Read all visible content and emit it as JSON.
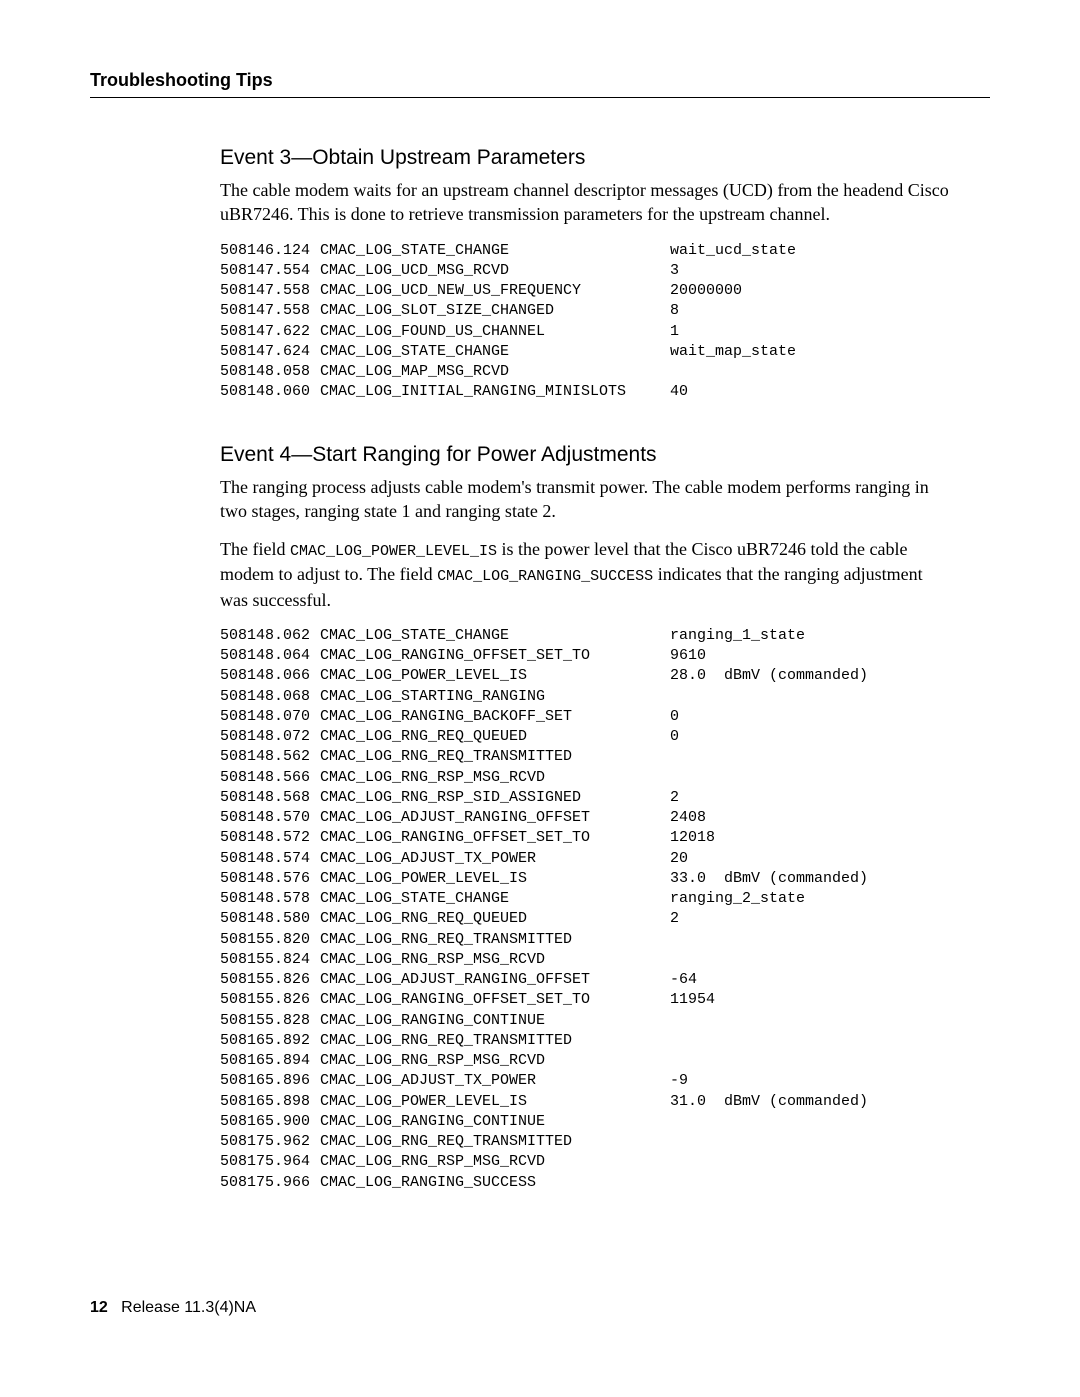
{
  "header": {
    "title": "Troubleshooting Tips"
  },
  "section1": {
    "heading": "Event  3—Obtain Upstream Parameters",
    "para": "The cable modem waits for an upstream channel descriptor messages (UCD) from the headend Cisco uBR7246. This is done to retrieve transmission parameters for the upstream channel.",
    "log": [
      {
        "ts": "508146.124",
        "ev": "CMAC_LOG_STATE_CHANGE",
        "val": "wait_ucd_state"
      },
      {
        "ts": "508147.554",
        "ev": "CMAC_LOG_UCD_MSG_RCVD",
        "val": "3"
      },
      {
        "ts": "508147.558",
        "ev": "CMAC_LOG_UCD_NEW_US_FREQUENCY",
        "val": "20000000"
      },
      {
        "ts": "508147.558",
        "ev": "CMAC_LOG_SLOT_SIZE_CHANGED",
        "val": "8"
      },
      {
        "ts": "508147.622",
        "ev": "CMAC_LOG_FOUND_US_CHANNEL",
        "val": "1"
      },
      {
        "ts": "508147.624",
        "ev": "CMAC_LOG_STATE_CHANGE",
        "val": "wait_map_state"
      },
      {
        "ts": "508148.058",
        "ev": "CMAC_LOG_MAP_MSG_RCVD",
        "val": ""
      },
      {
        "ts": "508148.060",
        "ev": "CMAC_LOG_INITIAL_RANGING_MINISLOTS",
        "val": "40"
      }
    ]
  },
  "section2": {
    "heading": "Event  4—Start Ranging for Power Adjustments",
    "para1": "The ranging process adjusts cable modem's transmit power. The cable modem performs ranging in two stages, ranging state 1 and ranging state 2.",
    "para2a": "The field ",
    "code1": "CMAC_LOG_POWER_LEVEL_IS",
    "para2b": " is the power level that the Cisco uBR7246 told the cable modem to adjust to. The field ",
    "code2": "CMAC_LOG_RANGING_SUCCESS",
    "para2c": " indicates that the ranging adjustment was successful.",
    "log": [
      {
        "ts": "508148.062",
        "ev": "CMAC_LOG_STATE_CHANGE",
        "val": "ranging_1_state"
      },
      {
        "ts": "508148.064",
        "ev": "CMAC_LOG_RANGING_OFFSET_SET_TO",
        "val": "9610"
      },
      {
        "ts": "508148.066",
        "ev": "CMAC_LOG_POWER_LEVEL_IS",
        "val": "28.0  dBmV (commanded)"
      },
      {
        "ts": "508148.068",
        "ev": "CMAC_LOG_STARTING_RANGING",
        "val": ""
      },
      {
        "ts": "508148.070",
        "ev": "CMAC_LOG_RANGING_BACKOFF_SET",
        "val": "0"
      },
      {
        "ts": "508148.072",
        "ev": "CMAC_LOG_RNG_REQ_QUEUED",
        "val": "0"
      },
      {
        "ts": "508148.562",
        "ev": "CMAC_LOG_RNG_REQ_TRANSMITTED",
        "val": ""
      },
      {
        "ts": "508148.566",
        "ev": "CMAC_LOG_RNG_RSP_MSG_RCVD",
        "val": ""
      },
      {
        "ts": "508148.568",
        "ev": "CMAC_LOG_RNG_RSP_SID_ASSIGNED",
        "val": "2"
      },
      {
        "ts": "508148.570",
        "ev": "CMAC_LOG_ADJUST_RANGING_OFFSET",
        "val": "2408"
      },
      {
        "ts": "508148.572",
        "ev": "CMAC_LOG_RANGING_OFFSET_SET_TO",
        "val": "12018"
      },
      {
        "ts": "508148.574",
        "ev": "CMAC_LOG_ADJUST_TX_POWER",
        "val": "20"
      },
      {
        "ts": "508148.576",
        "ev": "CMAC_LOG_POWER_LEVEL_IS",
        "val": "33.0  dBmV (commanded)"
      },
      {
        "ts": "508148.578",
        "ev": "CMAC_LOG_STATE_CHANGE",
        "val": "ranging_2_state"
      },
      {
        "ts": "508148.580",
        "ev": "CMAC_LOG_RNG_REQ_QUEUED",
        "val": "2"
      },
      {
        "ts": "508155.820",
        "ev": "CMAC_LOG_RNG_REQ_TRANSMITTED",
        "val": ""
      },
      {
        "ts": "508155.824",
        "ev": "CMAC_LOG_RNG_RSP_MSG_RCVD",
        "val": ""
      },
      {
        "ts": "508155.826",
        "ev": "CMAC_LOG_ADJUST_RANGING_OFFSET",
        "val": "-64"
      },
      {
        "ts": "508155.826",
        "ev": "CMAC_LOG_RANGING_OFFSET_SET_TO",
        "val": "11954"
      },
      {
        "ts": "508155.828",
        "ev": "CMAC_LOG_RANGING_CONTINUE",
        "val": ""
      },
      {
        "ts": "508165.892",
        "ev": "CMAC_LOG_RNG_REQ_TRANSMITTED",
        "val": ""
      },
      {
        "ts": "508165.894",
        "ev": "CMAC_LOG_RNG_RSP_MSG_RCVD",
        "val": ""
      },
      {
        "ts": "508165.896",
        "ev": "CMAC_LOG_ADJUST_TX_POWER",
        "val": "-9"
      },
      {
        "ts": "508165.898",
        "ev": "CMAC_LOG_POWER_LEVEL_IS",
        "val": "31.0  dBmV (commanded)"
      },
      {
        "ts": "508165.900",
        "ev": "CMAC_LOG_RANGING_CONTINUE",
        "val": ""
      },
      {
        "ts": "508175.962",
        "ev": "CMAC_LOG_RNG_REQ_TRANSMITTED",
        "val": ""
      },
      {
        "ts": "508175.964",
        "ev": "CMAC_LOG_RNG_RSP_MSG_RCVD",
        "val": ""
      },
      {
        "ts": "508175.966",
        "ev": "CMAC_LOG_RANGING_SUCCESS",
        "val": ""
      }
    ]
  },
  "footer": {
    "page": "12",
    "release": "Release 11.3(4)NA"
  }
}
